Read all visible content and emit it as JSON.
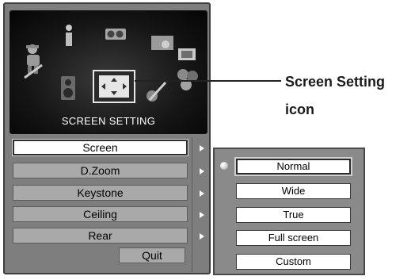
{
  "panel": {
    "title": "SCREEN SETTING",
    "icons": [
      "technician-icon",
      "info-icon",
      "projector-icon",
      "screen-image-icon",
      "settings-screen-icon",
      "speaker-icon",
      "screen-setting-icon",
      "color-balls-icon",
      "filter-icon"
    ],
    "selected_icon": "screen-setting-icon"
  },
  "menu": {
    "items": [
      {
        "label": "Screen",
        "selected": true
      },
      {
        "label": "D.Zoom",
        "selected": false
      },
      {
        "label": "Keystone",
        "selected": false
      },
      {
        "label": "Ceiling",
        "selected": false
      },
      {
        "label": "Rear",
        "selected": false
      }
    ],
    "quit_label": "Quit"
  },
  "submenu": {
    "items": [
      {
        "label": "Normal",
        "selected": true
      },
      {
        "label": "Wide",
        "selected": false
      },
      {
        "label": "True",
        "selected": false
      },
      {
        "label": "Full screen",
        "selected": false
      },
      {
        "label": "Custom",
        "selected": false
      }
    ]
  },
  "callout": {
    "line1": "Screen Setting",
    "line2": "icon"
  },
  "colors": {
    "panel_bg": "#7e7e7e",
    "icon_panel_bg": "#151515",
    "menu_item_bg": "#a9a9a9",
    "selected_bg": "#ffffff"
  }
}
